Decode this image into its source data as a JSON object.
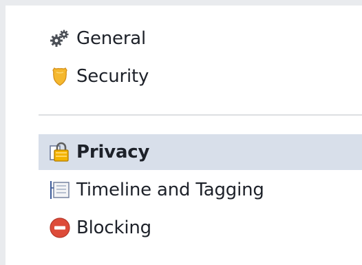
{
  "settings_nav": {
    "group1": [
      {
        "label": "General",
        "icon": "gears-icon"
      },
      {
        "label": "Security",
        "icon": "shield-badge-icon"
      }
    ],
    "group2": [
      {
        "label": "Privacy",
        "icon": "padlock-icon",
        "active": true
      },
      {
        "label": "Timeline and Tagging",
        "icon": "timeline-icon"
      },
      {
        "label": "Blocking",
        "icon": "blocking-icon"
      }
    ]
  },
  "colors": {
    "active_bg": "#d8dfea",
    "text": "#1d2129",
    "divider": "#dddfe2",
    "blocking_red": "#dd4b39",
    "badge_gold": "#f5b82e"
  }
}
